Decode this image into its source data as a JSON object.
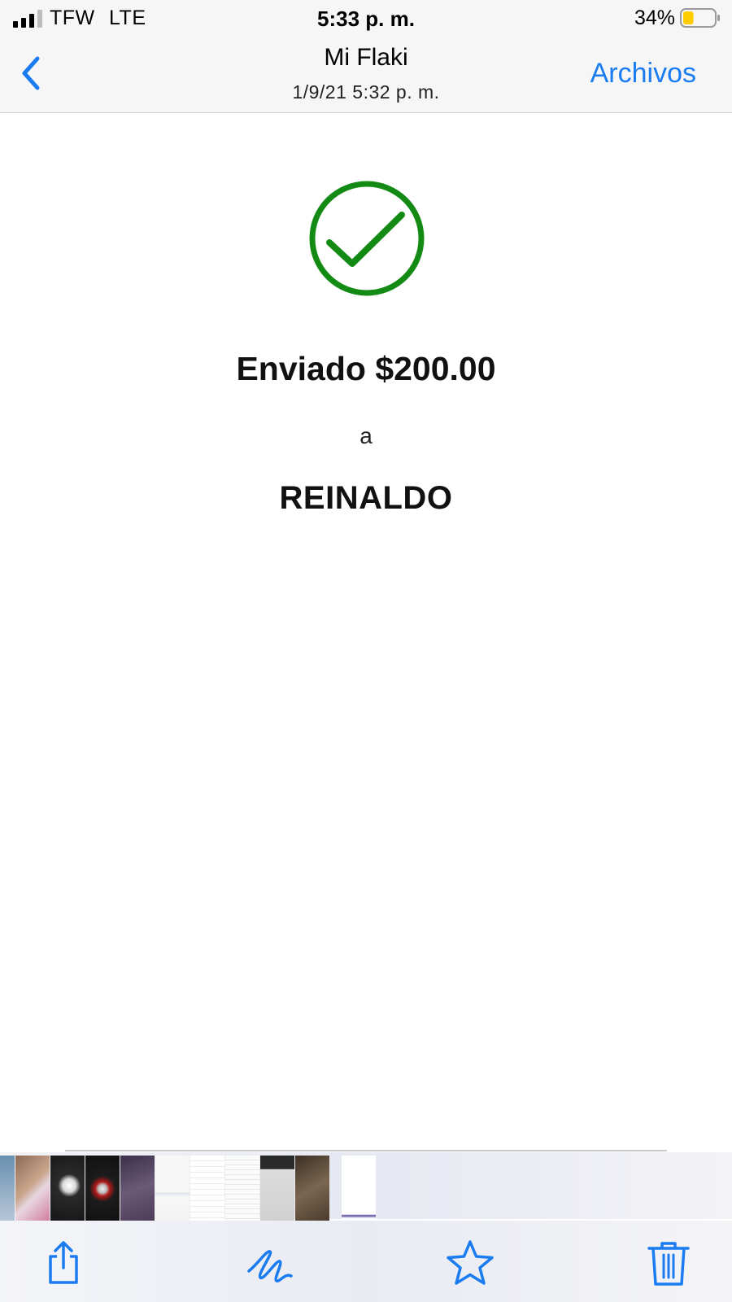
{
  "status_bar": {
    "carrier": "TFW",
    "network": "LTE",
    "time": "5:33 p. m.",
    "battery_percent": "34%",
    "battery_level": 0.34,
    "battery_color": "#ffcc00",
    "signal_bars": 3
  },
  "nav": {
    "back_icon": "chevron-left-icon",
    "title": "Mi Flaki",
    "subtitle": "1/9/21 5:32 p. m.",
    "archivos_label": "Archivos",
    "accent_color": "#1a7cf0"
  },
  "receipt": {
    "status_icon": "checkmark-circle-icon",
    "status_color": "#138a13",
    "sent_text": "Enviado $200.00",
    "connector": "a",
    "recipient": "REINALDO"
  },
  "thumbnail_strip": {
    "count": 11,
    "selected_index": 10
  },
  "toolbar": {
    "items": [
      "share-icon",
      "markup-icon",
      "favorite-star-icon",
      "trash-icon"
    ]
  }
}
